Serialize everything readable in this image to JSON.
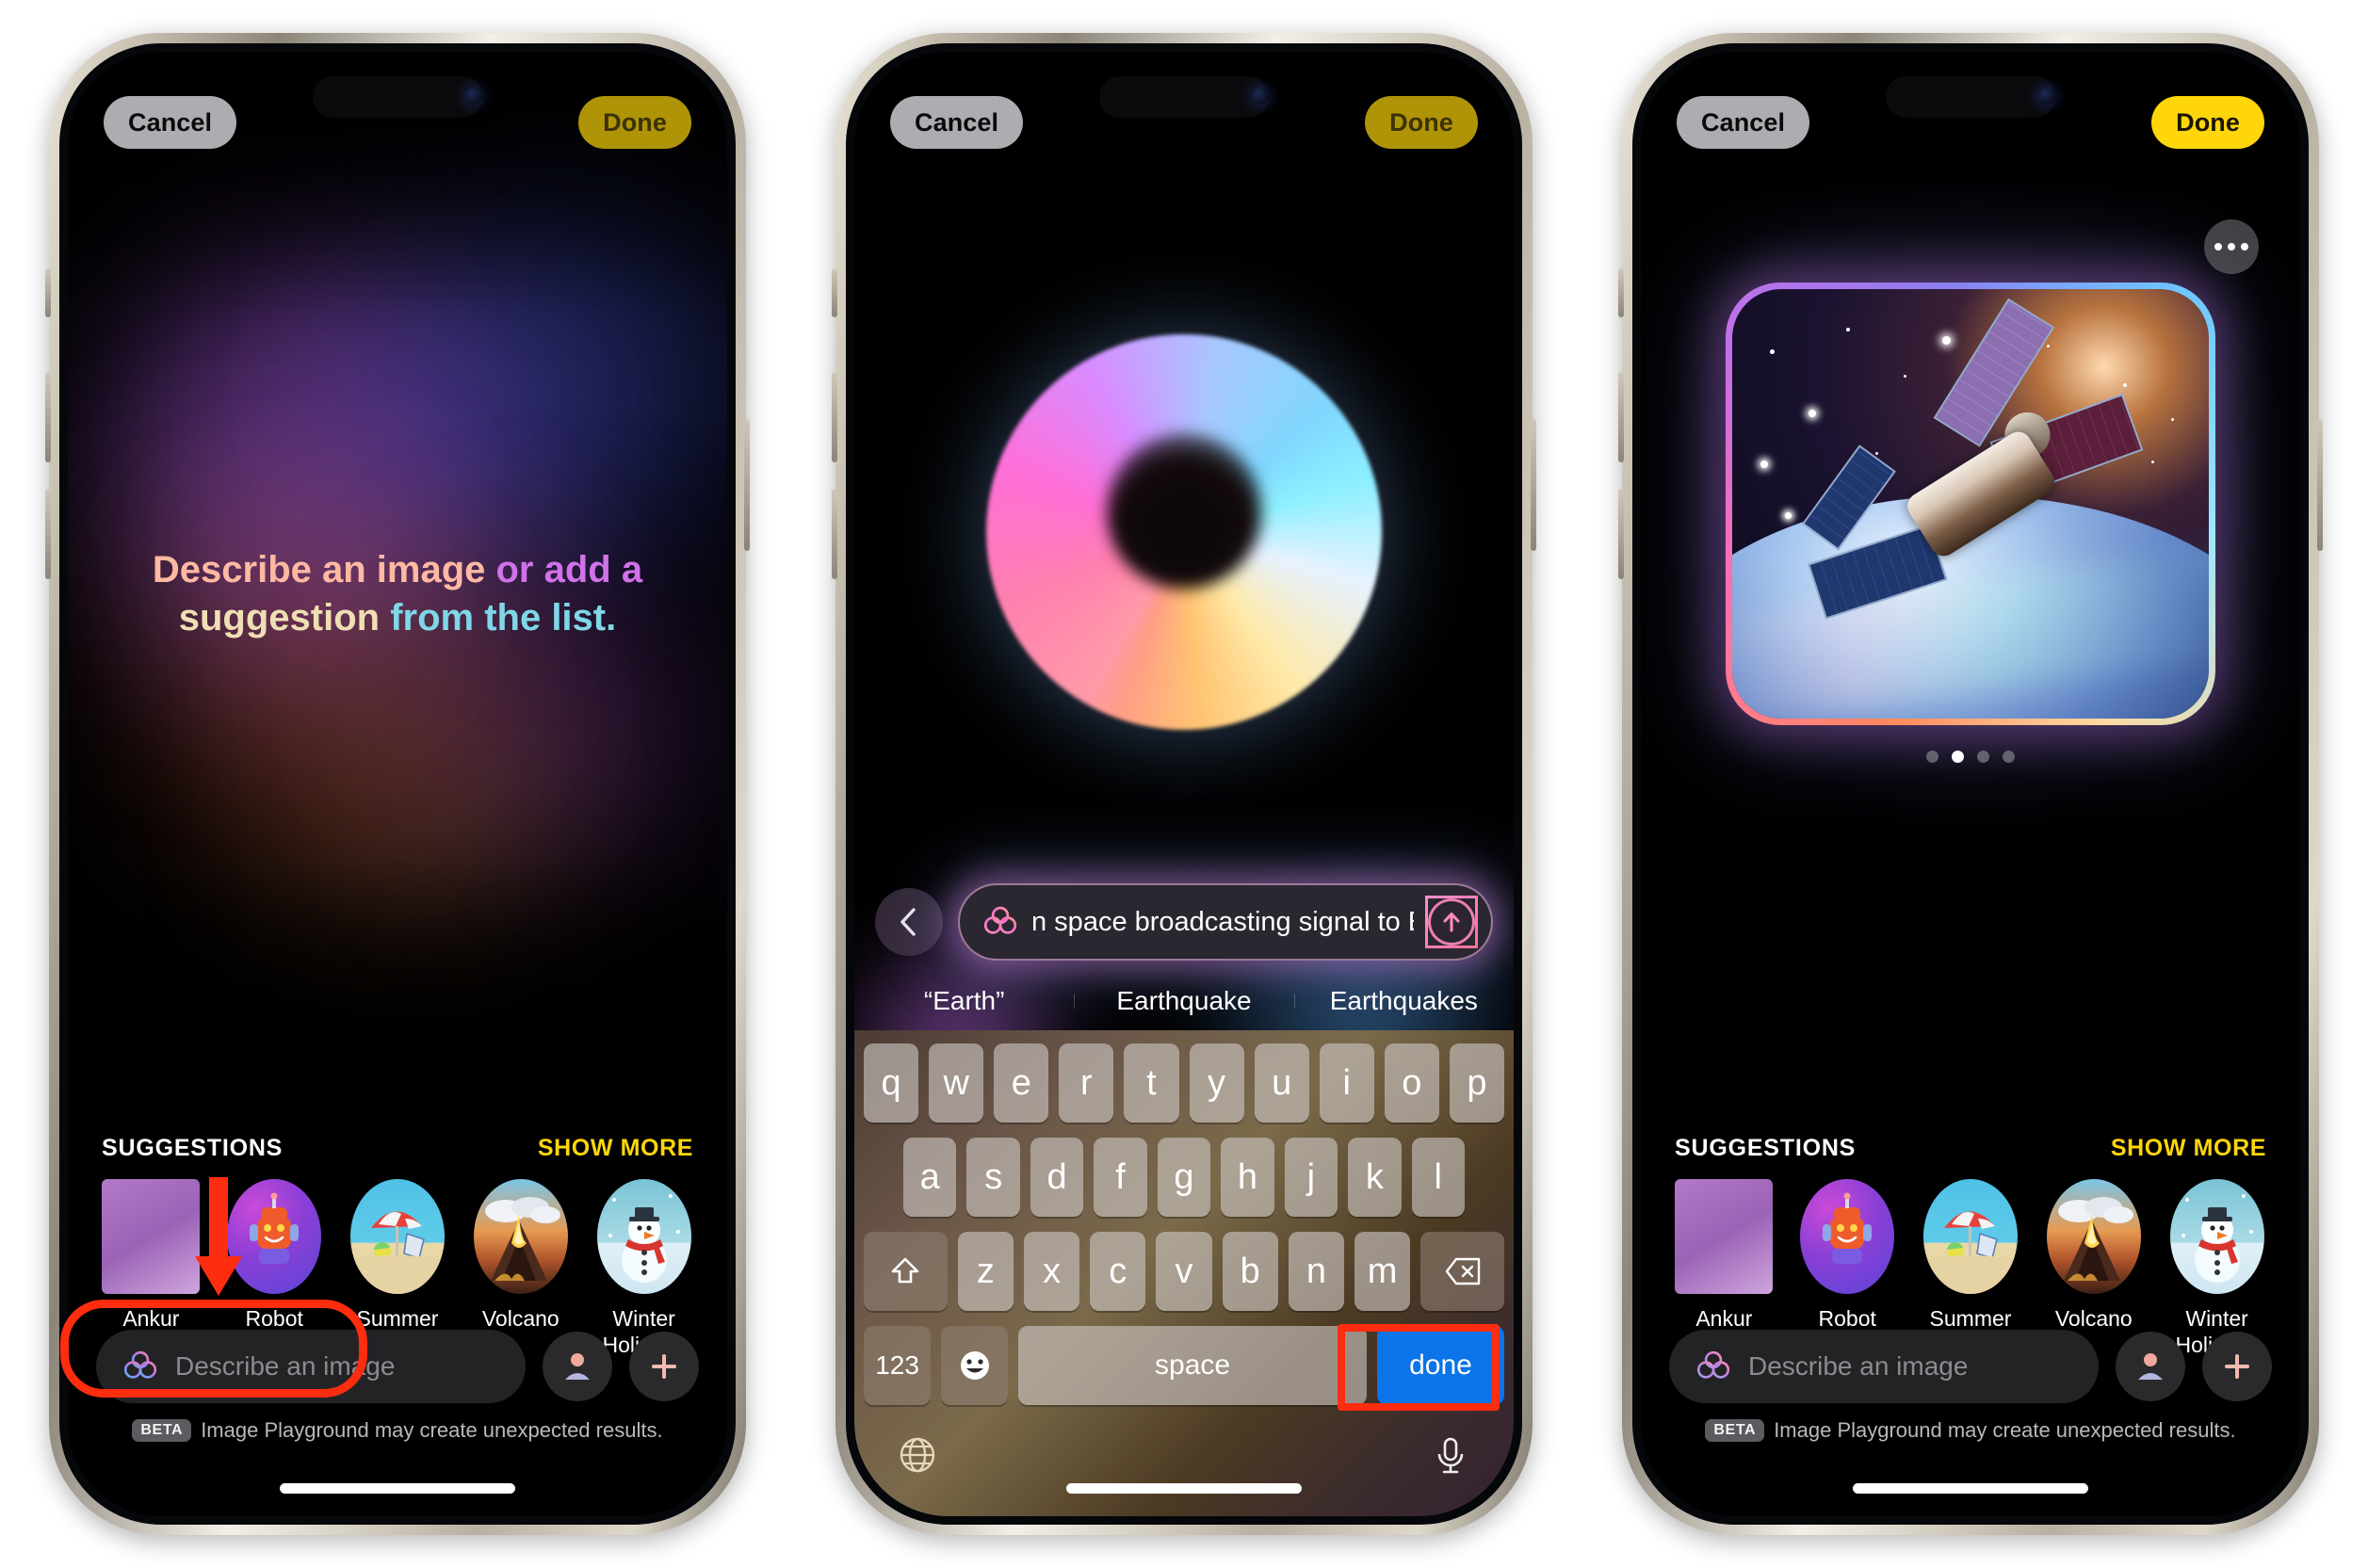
{
  "nav": {
    "cancel_label": "Cancel",
    "done_label": "Done"
  },
  "screen1": {
    "hero": {
      "part1": "Describe an image ",
      "part2": "or add a",
      "part3": "suggestion ",
      "part4": "from the list."
    },
    "suggestions": {
      "title": "SUGGESTIONS",
      "show_more": "SHOW MORE",
      "items": [
        {
          "label": "Ankur",
          "art": "person-placeholder"
        },
        {
          "label": "Robot",
          "art": "robot"
        },
        {
          "label": "Summer",
          "art": "beach-umbrella"
        },
        {
          "label": "Volcano",
          "art": "volcano"
        },
        {
          "label": "Winter Holidays",
          "art": "snowman"
        }
      ]
    },
    "input": {
      "placeholder": "Describe an image",
      "value": "",
      "ai_icon": "apple-intelligence-icon",
      "person_icon": "person-icon",
      "plus_icon": "plus-icon"
    },
    "disclaimer": {
      "badge": "BETA",
      "text": "Image Playground may create unexpected results."
    },
    "annotation": {
      "highlight": "describe-an-image-field",
      "arrow": "red-down-arrow"
    }
  },
  "screen2": {
    "compose": {
      "value": "n space broadcasting signal to Earth",
      "back_icon": "chevron-left-icon",
      "ai_icon": "apple-intelligence-icon",
      "send_icon": "arrow-up-icon"
    },
    "predictions": [
      "“Earth”",
      "Earthquake",
      "Earthquakes"
    ],
    "keyboard": {
      "row1": [
        "q",
        "w",
        "e",
        "r",
        "t",
        "y",
        "u",
        "i",
        "o",
        "p"
      ],
      "row2": [
        "a",
        "s",
        "d",
        "f",
        "g",
        "h",
        "j",
        "k",
        "l"
      ],
      "row3": [
        "z",
        "x",
        "c",
        "v",
        "b",
        "n",
        "m"
      ],
      "shift_icon": "shift-icon",
      "backspace_icon": "backspace-icon",
      "numbers_label": "123",
      "emoji_icon": "emoji-icon",
      "space_label": "space",
      "return_label": "done",
      "globe_icon": "globe-icon",
      "mic_icon": "microphone-icon"
    },
    "annotation": {
      "highlight": "keyboard-done-key"
    }
  },
  "screen3": {
    "more_icon": "ellipsis-icon",
    "result": {
      "alt": "satellite-in-space-over-earth",
      "page_dots": 4,
      "active_dot": 2
    },
    "suggestions": {
      "title": "SUGGESTIONS",
      "show_more": "SHOW MORE",
      "items": [
        {
          "label": "Ankur",
          "art": "person-placeholder"
        },
        {
          "label": "Robot",
          "art": "robot"
        },
        {
          "label": "Summer",
          "art": "beach-umbrella"
        },
        {
          "label": "Volcano",
          "art": "volcano"
        },
        {
          "label": "Winter Holidays",
          "art": "snowman"
        }
      ]
    },
    "input": {
      "placeholder": "Describe an image",
      "value": "",
      "ai_icon": "apple-intelligence-icon",
      "person_icon": "person-icon",
      "plus_icon": "plus-icon"
    },
    "disclaimer": {
      "badge": "BETA",
      "text": "Image Playground may create unexpected results."
    }
  },
  "colors": {
    "accent_yellow": "#ffd60a",
    "accent_yellow_dim": "#b09408",
    "annotation_red": "#ff2d0f",
    "return_blue": "#0a74e8",
    "cancel_grey": "#acacb1"
  }
}
